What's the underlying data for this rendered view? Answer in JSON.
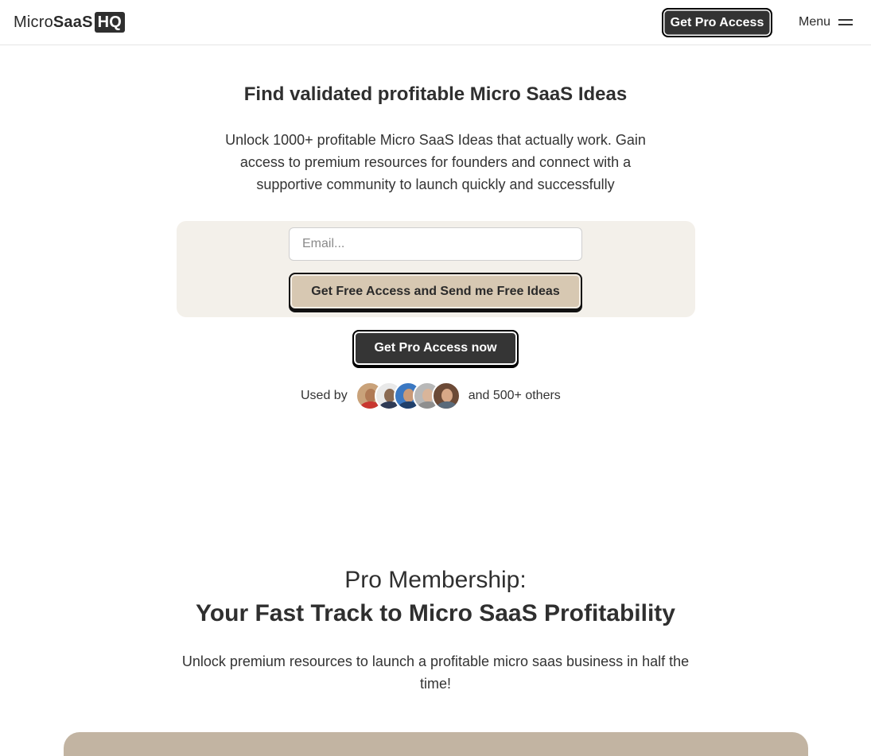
{
  "nav": {
    "logo_micro": "Micro",
    "logo_saas": "SaaS",
    "logo_hq": "HQ",
    "pro_button": "Get Pro Access",
    "menu_label": "Menu"
  },
  "hero": {
    "title": "Find validated profitable Micro SaaS Ideas",
    "subtitle": "Unlock 1000+ profitable Micro SaaS Ideas that actually work. Gain access to premium resources for founders and connect with a supportive community to launch quickly and successfully",
    "email_placeholder": "Email...",
    "free_button": "Get Free Access and Send me Free Ideas",
    "pro_button": "Get Pro Access now",
    "used_by_prefix": "Used by",
    "used_by_suffix": "and 500+ others"
  },
  "pro_section": {
    "title_line1": "Pro Membership:",
    "title_line2": "Your Fast Track to Micro SaaS Profitability",
    "subtitle": "Unlock premium resources to launch a profitable micro saas business in half the time!"
  },
  "colors": {
    "accent_dark": "#353535",
    "beige_button": "#d7c8b2",
    "panel_bg": "#f3f0ea",
    "card_bg": "#c2b4a2"
  }
}
